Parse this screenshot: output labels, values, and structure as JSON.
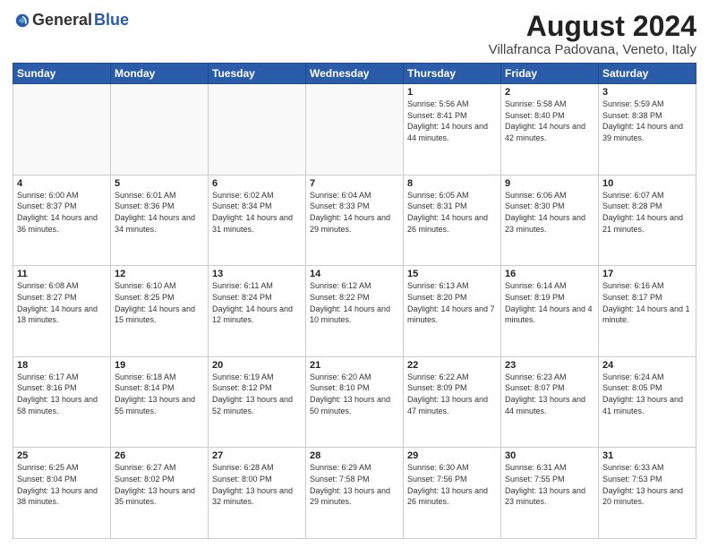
{
  "logo": {
    "general": "General",
    "blue": "Blue"
  },
  "header": {
    "month": "August 2024",
    "location": "Villafranca Padovana, Veneto, Italy"
  },
  "days_of_week": [
    "Sunday",
    "Monday",
    "Tuesday",
    "Wednesday",
    "Thursday",
    "Friday",
    "Saturday"
  ],
  "weeks": [
    [
      {
        "day": "",
        "info": ""
      },
      {
        "day": "",
        "info": ""
      },
      {
        "day": "",
        "info": ""
      },
      {
        "day": "",
        "info": ""
      },
      {
        "day": "1",
        "info": "Sunrise: 5:56 AM\nSunset: 8:41 PM\nDaylight: 14 hours\nand 44 minutes."
      },
      {
        "day": "2",
        "info": "Sunrise: 5:58 AM\nSunset: 8:40 PM\nDaylight: 14 hours\nand 42 minutes."
      },
      {
        "day": "3",
        "info": "Sunrise: 5:59 AM\nSunset: 8:38 PM\nDaylight: 14 hours\nand 39 minutes."
      }
    ],
    [
      {
        "day": "4",
        "info": "Sunrise: 6:00 AM\nSunset: 8:37 PM\nDaylight: 14 hours\nand 36 minutes."
      },
      {
        "day": "5",
        "info": "Sunrise: 6:01 AM\nSunset: 8:36 PM\nDaylight: 14 hours\nand 34 minutes."
      },
      {
        "day": "6",
        "info": "Sunrise: 6:02 AM\nSunset: 8:34 PM\nDaylight: 14 hours\nand 31 minutes."
      },
      {
        "day": "7",
        "info": "Sunrise: 6:04 AM\nSunset: 8:33 PM\nDaylight: 14 hours\nand 29 minutes."
      },
      {
        "day": "8",
        "info": "Sunrise: 6:05 AM\nSunset: 8:31 PM\nDaylight: 14 hours\nand 26 minutes."
      },
      {
        "day": "9",
        "info": "Sunrise: 6:06 AM\nSunset: 8:30 PM\nDaylight: 14 hours\nand 23 minutes."
      },
      {
        "day": "10",
        "info": "Sunrise: 6:07 AM\nSunset: 8:28 PM\nDaylight: 14 hours\nand 21 minutes."
      }
    ],
    [
      {
        "day": "11",
        "info": "Sunrise: 6:08 AM\nSunset: 8:27 PM\nDaylight: 14 hours\nand 18 minutes."
      },
      {
        "day": "12",
        "info": "Sunrise: 6:10 AM\nSunset: 8:25 PM\nDaylight: 14 hours\nand 15 minutes."
      },
      {
        "day": "13",
        "info": "Sunrise: 6:11 AM\nSunset: 8:24 PM\nDaylight: 14 hours\nand 12 minutes."
      },
      {
        "day": "14",
        "info": "Sunrise: 6:12 AM\nSunset: 8:22 PM\nDaylight: 14 hours\nand 10 minutes."
      },
      {
        "day": "15",
        "info": "Sunrise: 6:13 AM\nSunset: 8:20 PM\nDaylight: 14 hours\nand 7 minutes."
      },
      {
        "day": "16",
        "info": "Sunrise: 6:14 AM\nSunset: 8:19 PM\nDaylight: 14 hours\nand 4 minutes."
      },
      {
        "day": "17",
        "info": "Sunrise: 6:16 AM\nSunset: 8:17 PM\nDaylight: 14 hours\nand 1 minute."
      }
    ],
    [
      {
        "day": "18",
        "info": "Sunrise: 6:17 AM\nSunset: 8:16 PM\nDaylight: 13 hours\nand 58 minutes."
      },
      {
        "day": "19",
        "info": "Sunrise: 6:18 AM\nSunset: 8:14 PM\nDaylight: 13 hours\nand 55 minutes."
      },
      {
        "day": "20",
        "info": "Sunrise: 6:19 AM\nSunset: 8:12 PM\nDaylight: 13 hours\nand 52 minutes."
      },
      {
        "day": "21",
        "info": "Sunrise: 6:20 AM\nSunset: 8:10 PM\nDaylight: 13 hours\nand 50 minutes."
      },
      {
        "day": "22",
        "info": "Sunrise: 6:22 AM\nSunset: 8:09 PM\nDaylight: 13 hours\nand 47 minutes."
      },
      {
        "day": "23",
        "info": "Sunrise: 6:23 AM\nSunset: 8:07 PM\nDaylight: 13 hours\nand 44 minutes."
      },
      {
        "day": "24",
        "info": "Sunrise: 6:24 AM\nSunset: 8:05 PM\nDaylight: 13 hours\nand 41 minutes."
      }
    ],
    [
      {
        "day": "25",
        "info": "Sunrise: 6:25 AM\nSunset: 8:04 PM\nDaylight: 13 hours\nand 38 minutes."
      },
      {
        "day": "26",
        "info": "Sunrise: 6:27 AM\nSunset: 8:02 PM\nDaylight: 13 hours\nand 35 minutes."
      },
      {
        "day": "27",
        "info": "Sunrise: 6:28 AM\nSunset: 8:00 PM\nDaylight: 13 hours\nand 32 minutes."
      },
      {
        "day": "28",
        "info": "Sunrise: 6:29 AM\nSunset: 7:58 PM\nDaylight: 13 hours\nand 29 minutes."
      },
      {
        "day": "29",
        "info": "Sunrise: 6:30 AM\nSunset: 7:56 PM\nDaylight: 13 hours\nand 26 minutes."
      },
      {
        "day": "30",
        "info": "Sunrise: 6:31 AM\nSunset: 7:55 PM\nDaylight: 13 hours\nand 23 minutes."
      },
      {
        "day": "31",
        "info": "Sunrise: 6:33 AM\nSunset: 7:53 PM\nDaylight: 13 hours\nand 20 minutes."
      }
    ]
  ]
}
